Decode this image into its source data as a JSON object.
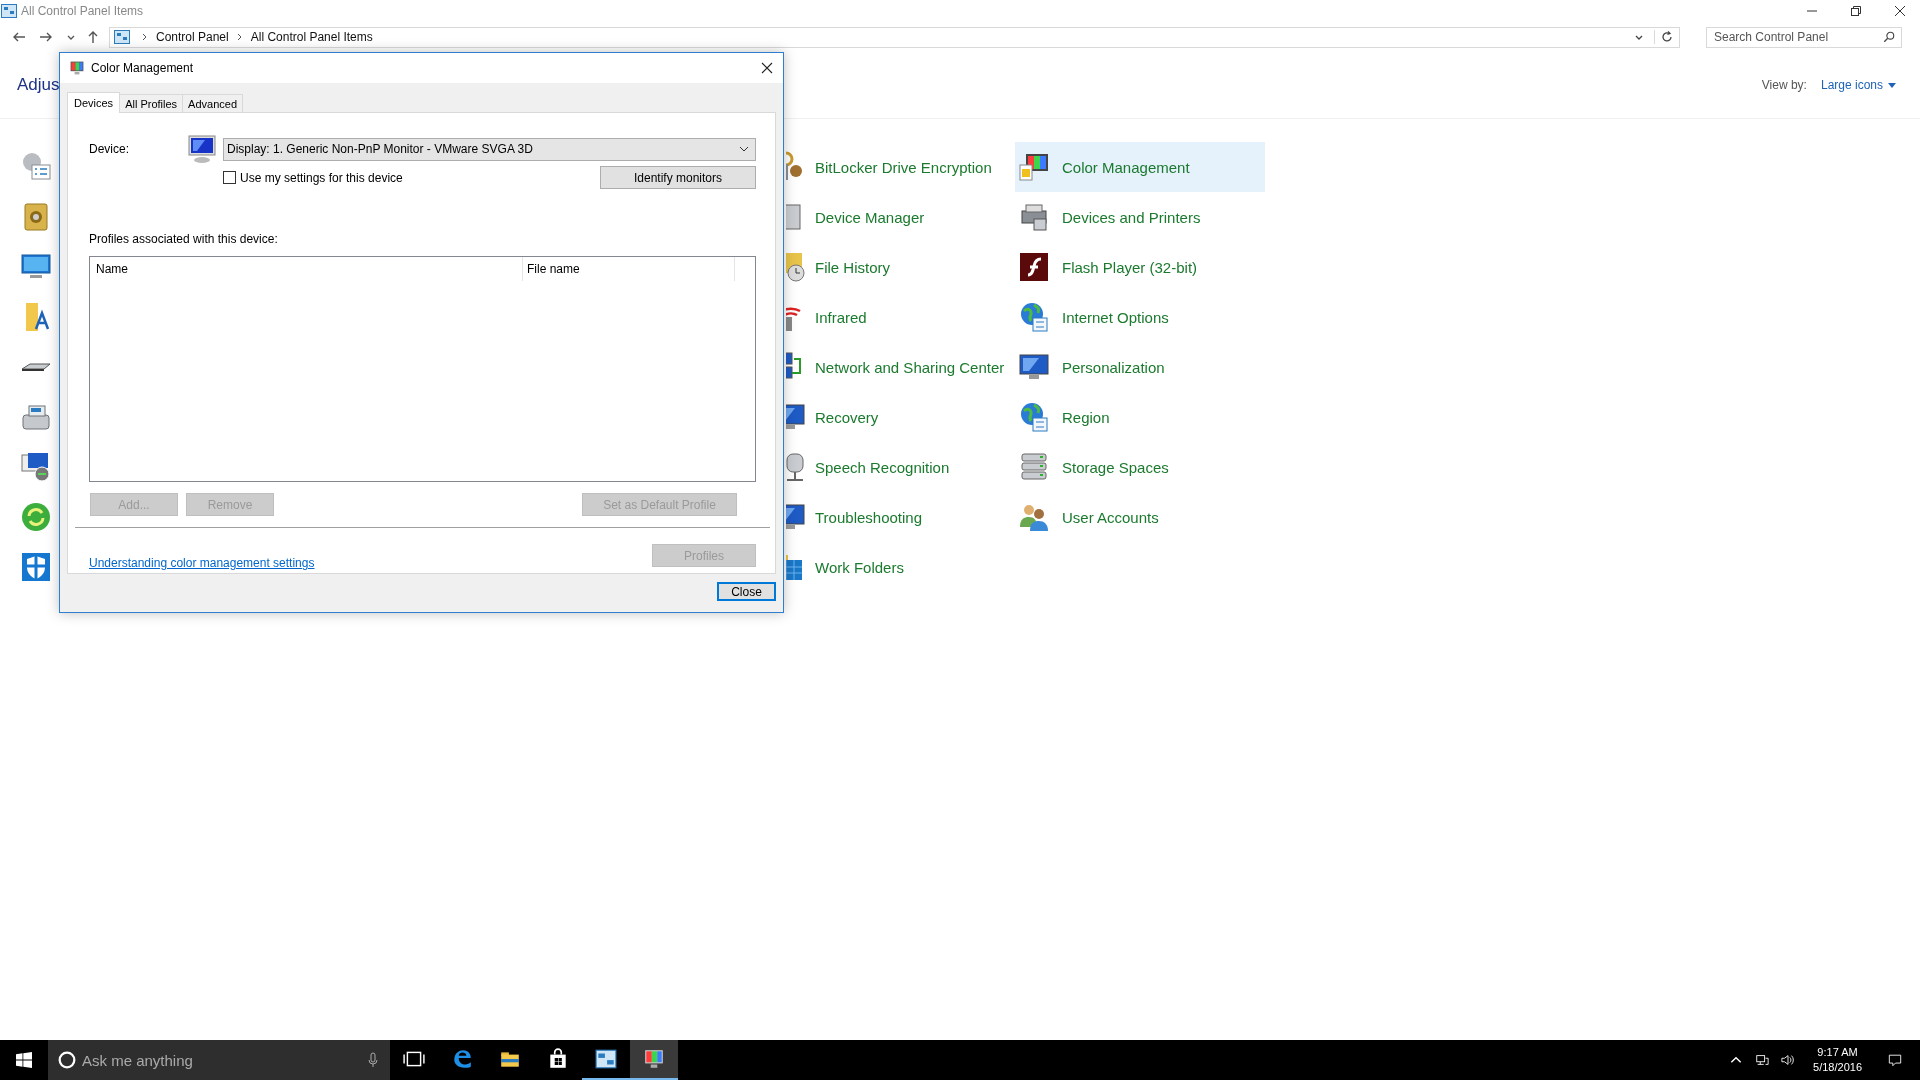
{
  "window": {
    "title": "All Control Panel Items"
  },
  "address_bar": {
    "path": [
      "Control Panel",
      "All Control Panel Items"
    ]
  },
  "search": {
    "placeholder": "Search Control Panel"
  },
  "header": {
    "title": "Adjus",
    "view_by_label": "View by:",
    "view_by_value": "Large icons"
  },
  "columns": [
    {
      "items": [
        {
          "label": "BitLocker Drive Encryption",
          "selected": false
        },
        {
          "label": "Device Manager",
          "selected": false
        },
        {
          "label": "File History",
          "selected": false
        },
        {
          "label": "Infrared",
          "selected": false
        },
        {
          "label": "Network and Sharing Center",
          "selected": false
        },
        {
          "label": "Recovery",
          "selected": false
        },
        {
          "label": "Speech Recognition",
          "selected": false
        },
        {
          "label": "Troubleshooting",
          "selected": false
        },
        {
          "label": "Work Folders",
          "selected": false
        }
      ]
    },
    {
      "items": [
        {
          "label": "Color Management",
          "selected": true
        },
        {
          "label": "Devices and Printers",
          "selected": false
        },
        {
          "label": "Flash Player (32-bit)",
          "selected": false
        },
        {
          "label": "Internet Options",
          "selected": false
        },
        {
          "label": "Personalization",
          "selected": false
        },
        {
          "label": "Region",
          "selected": false
        },
        {
          "label": "Storage Spaces",
          "selected": false
        },
        {
          "label": "User Accounts",
          "selected": false
        }
      ]
    }
  ],
  "dialog": {
    "title": "Color Management",
    "tabs": [
      {
        "label": "Devices",
        "selected": true
      },
      {
        "label": "All Profiles",
        "selected": false
      },
      {
        "label": "Advanced",
        "selected": false
      }
    ],
    "device_label": "Device:",
    "device_value": "Display: 1. Generic Non-PnP Monitor - VMware SVGA 3D",
    "use_my_settings": {
      "label": "Use my settings for this device",
      "checked": false
    },
    "identify_button": "Identify monitors",
    "profiles_label": "Profiles associated with this device:",
    "table": {
      "columns": [
        "Name",
        "File name"
      ]
    },
    "buttons": [
      {
        "label": "Add...",
        "disabled": true
      },
      {
        "label": "Remove",
        "disabled": true
      },
      {
        "label": "Set as Default Profile",
        "disabled": true
      }
    ],
    "link": "Understanding color management settings",
    "profiles_button": {
      "label": "Profiles",
      "disabled": true
    },
    "close_button": "Close"
  },
  "taskbar": {
    "search_placeholder": "Ask me anything",
    "apps": [
      {
        "kind": "edge",
        "running": false,
        "selected": false
      },
      {
        "kind": "explorer",
        "running": false,
        "selected": false
      },
      {
        "kind": "store",
        "running": false,
        "selected": false
      },
      {
        "kind": "control-panel",
        "running": true,
        "selected": false
      },
      {
        "kind": "color",
        "running": true,
        "selected": true
      }
    ],
    "time": "9:17 AM",
    "date": "5/18/2016"
  }
}
